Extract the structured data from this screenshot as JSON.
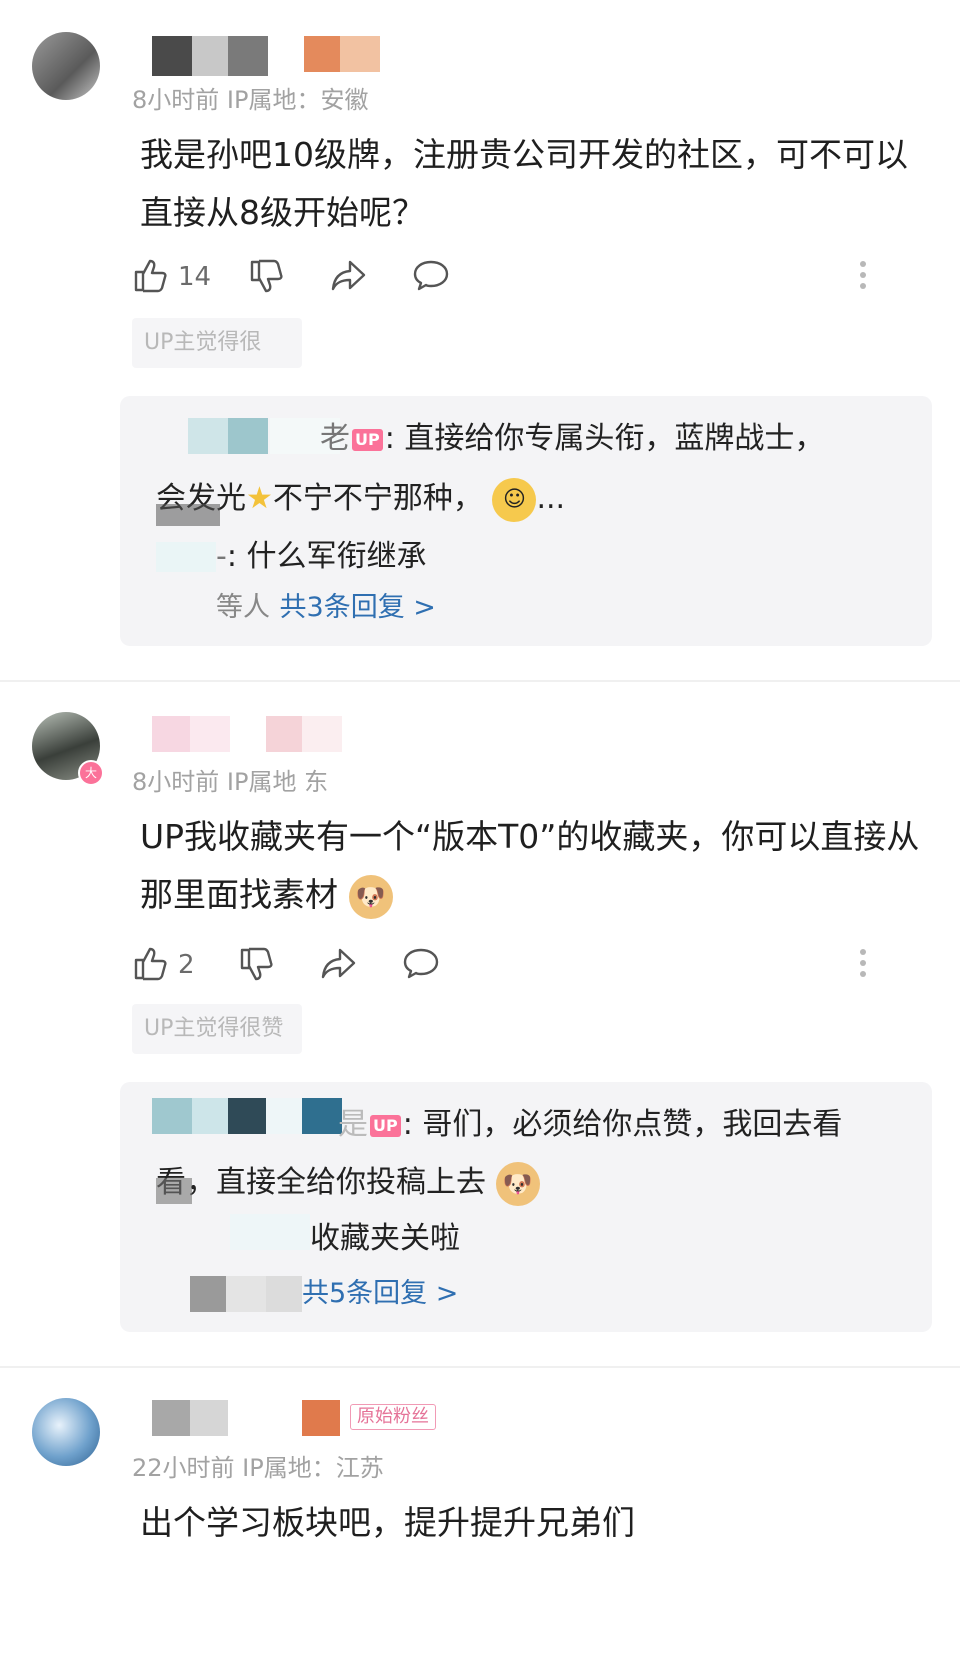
{
  "comments": [
    {
      "meta": "8小时前  IP属地：安徽",
      "text": "我是孙吧10级牌，注册贵公司开发的社区，可不可以直接从8级开始呢？",
      "likes": "14",
      "up_note": "UP主觉得很",
      "replies": [
        {
          "user_suffix": "老",
          "text_a": "直接给你专属头衔，蓝牌战士，",
          "text_b": "会发光",
          "text_c": "不宁不宁那种，",
          "text_d": "..."
        },
        {
          "user_suffix": "-",
          "text": "什么军衔继承"
        }
      ],
      "reply_footer_prefix": "等人",
      "reply_more": "共3条回复 >"
    },
    {
      "meta": "8小时前  IP属地  东",
      "text": "UP我收藏夹有一个“版本T0”的收藏夹，你可以直接从那里面找素材",
      "likes": "2",
      "up_note": "UP主觉得很赞",
      "replies": [
        {
          "user_suffix": "是",
          "text_a": "哥们，必须给你点赞，我回去看",
          "text_b": "看，直接全给你投稿上去"
        },
        {
          "user_suffix": "",
          "text": "收藏夹关啦"
        }
      ],
      "reply_more": "共5条回复 >"
    },
    {
      "meta": "22小时前  IP属地：江苏",
      "badge": "原始粉丝",
      "text": "出个学习板块吧，提升提升兄弟们"
    }
  ],
  "labels": {
    "up": "UP",
    "level_badge": "大"
  },
  "colors": {
    "link": "#2f6fb1",
    "up_pink": "#fb7299"
  }
}
